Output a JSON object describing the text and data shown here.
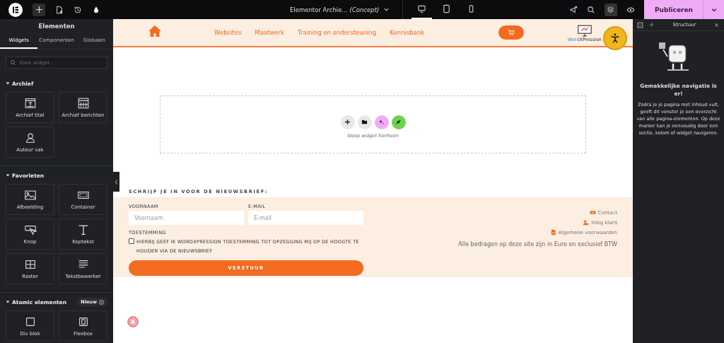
{
  "topbar": {
    "document_title": "Elementor Archie…",
    "status": "(Concept)",
    "devices": [
      {
        "kind": "desktop",
        "selected": true
      },
      {
        "kind": "tablet",
        "selected": false
      },
      {
        "kind": "mobile",
        "selected": false
      }
    ],
    "publish": "Publiceren"
  },
  "sidebar": {
    "title": "Elementen",
    "tabs": [
      {
        "label": "Widgets",
        "selected": true
      },
      {
        "label": "Componenten",
        "selected": false
      },
      {
        "label": "Globalen",
        "selected": false
      }
    ],
    "search": {
      "placeholder": "Zoek widget..."
    },
    "sections": [
      {
        "title": "Archief",
        "widgets": [
          {
            "label": "Archief titel",
            "kind": "title"
          },
          {
            "label": "Archief berichten",
            "kind": "posts"
          },
          {
            "label": "Auteur vak",
            "kind": "author"
          }
        ]
      },
      {
        "title": "Favorieten",
        "widgets": [
          {
            "label": "Afbeelding",
            "kind": "image"
          },
          {
            "label": "Container",
            "kind": "container"
          },
          {
            "label": "Knop",
            "kind": "button"
          },
          {
            "label": "Koptekst",
            "kind": "heading"
          },
          {
            "label": "Raster",
            "kind": "grid"
          },
          {
            "label": "Tekstbewerker",
            "kind": "text"
          }
        ]
      },
      {
        "title": "Atomic elementen",
        "badge": "Nieuw",
        "widgets": [
          {
            "label": "Div blok",
            "kind": "div"
          },
          {
            "label": "Flexbox",
            "kind": "flex"
          }
        ]
      }
    ]
  },
  "site": {
    "nav": [
      "Websites",
      "Maatwerk",
      "Training en ondersteuning",
      "Kennisbank"
    ],
    "logo": [
      "Word",
      "XPression"
    ],
    "dropzone": {
      "hint": "Sleep widget hierheen"
    },
    "newsletter": {
      "heading": "SCHRIJF JE IN VOOR DE NIEUWSBRIEF:",
      "fields": [
        {
          "label": "VOORNAAM",
          "placeholder": "Voornaam"
        },
        {
          "label": "E-MAIL",
          "placeholder": "E-mail"
        }
      ],
      "consent_label": "TOESTEMMING",
      "consent": {
        "text": "HIERBIJ GEEF IK WORDXPRESSION TOESTEMMING TOT OPZEGGING MIJ OP DE HOOGTE TE HOUDEN VIA DE NIEUWSBRIEF",
        "checked": false
      },
      "submit": "VERSTUUR"
    },
    "footer_links": [
      {
        "label": "Contact",
        "kind": "contact"
      },
      {
        "label": "Inlog klant",
        "kind": "user"
      },
      {
        "label": "Algemene voorwaarden",
        "kind": "document"
      }
    ],
    "disclaimer": "Alle bedragen op deze site zijn in Euro en exclusief BTW"
  },
  "structure": {
    "title": "Structuur",
    "heading": "Gemakkelijke navigatie is er!",
    "text": "Zodra je je pagina met inhoud vult, geeft dit venster je een overzicht van alle pagina-elementen. Op deze manier kan je eenvoudig door een sectie, kolom of widget navigeren."
  }
}
